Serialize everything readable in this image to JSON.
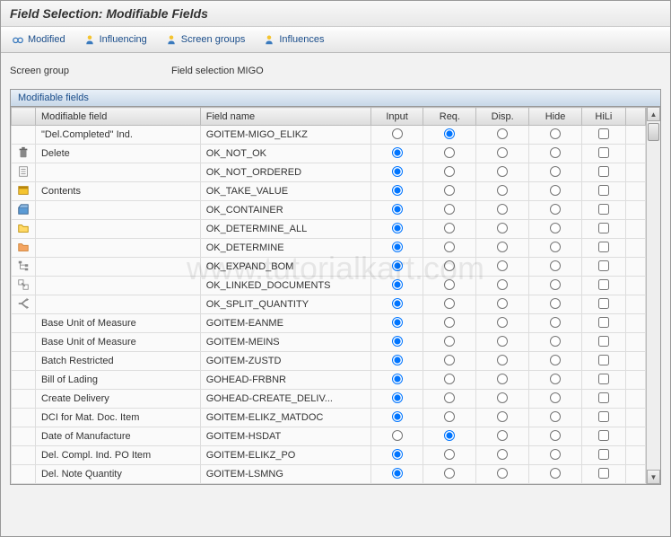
{
  "title": "Field Selection: Modifiable Fields",
  "toolbar": {
    "modified": "Modified",
    "influencing": "Influencing",
    "screen_groups": "Screen groups",
    "influences": "Influences"
  },
  "form": {
    "screen_group_label": "Screen group",
    "screen_group_value": "Field selection MIGO"
  },
  "table": {
    "title": "Modifiable fields",
    "headers": {
      "field": "Modifiable field",
      "name": "Field name",
      "input": "Input",
      "req": "Req.",
      "disp": "Disp.",
      "hide": "Hide",
      "hili": "HiLi"
    },
    "rows": [
      {
        "icon": "none",
        "field": "\"Del.Completed\" Ind.",
        "name": "GOITEM-MIGO_ELIKZ",
        "selected": "req",
        "hili": false
      },
      {
        "icon": "trash",
        "field": "Delete",
        "name": "OK_NOT_OK",
        "selected": "input",
        "hili": false
      },
      {
        "icon": "doc",
        "field": "",
        "name": "OK_NOT_ORDERED",
        "selected": "input",
        "hili": false
      },
      {
        "icon": "contents",
        "field": "Contents",
        "name": "OK_TAKE_VALUE",
        "selected": "input",
        "hili": false
      },
      {
        "icon": "container",
        "field": "",
        "name": "OK_CONTAINER",
        "selected": "input",
        "hili": false
      },
      {
        "icon": "folder-yellow",
        "field": "",
        "name": "OK_DETERMINE_ALL",
        "selected": "input",
        "hili": false
      },
      {
        "icon": "folder-orange",
        "field": "",
        "name": "OK_DETERMINE",
        "selected": "input",
        "hili": false
      },
      {
        "icon": "tree",
        "field": "",
        "name": "OK_EXPAND_BOM",
        "selected": "input",
        "hili": false
      },
      {
        "icon": "link",
        "field": "",
        "name": "OK_LINKED_DOCUMENTS",
        "selected": "input",
        "hili": false
      },
      {
        "icon": "split",
        "field": "",
        "name": "OK_SPLIT_QUANTITY",
        "selected": "input",
        "hili": false
      },
      {
        "icon": "none",
        "field": "Base Unit of Measure",
        "name": "GOITEM-EANME",
        "selected": "input",
        "hili": false
      },
      {
        "icon": "none",
        "field": "Base Unit of Measure",
        "name": "GOITEM-MEINS",
        "selected": "input",
        "hili": false
      },
      {
        "icon": "none",
        "field": "Batch Restricted",
        "name": "GOITEM-ZUSTD",
        "selected": "input",
        "hili": false
      },
      {
        "icon": "none",
        "field": "Bill of Lading",
        "name": "GOHEAD-FRBNR",
        "selected": "input",
        "hili": false
      },
      {
        "icon": "none",
        "field": "Create Delivery",
        "name": "GOHEAD-CREATE_DELIV...",
        "selected": "input",
        "hili": false
      },
      {
        "icon": "none",
        "field": "DCI for Mat. Doc. Item",
        "name": "GOITEM-ELIKZ_MATDOC",
        "selected": "input",
        "hili": false
      },
      {
        "icon": "none",
        "field": "Date of Manufacture",
        "name": "GOITEM-HSDAT",
        "selected": "req",
        "hili": false
      },
      {
        "icon": "none",
        "field": "Del. Compl. Ind. PO Item",
        "name": "GOITEM-ELIKZ_PO",
        "selected": "input",
        "hili": false
      },
      {
        "icon": "none",
        "field": "Del. Note Quantity",
        "name": "GOITEM-LSMNG",
        "selected": "input",
        "hili": false
      }
    ]
  },
  "watermark": "www.tutorialkart.com"
}
